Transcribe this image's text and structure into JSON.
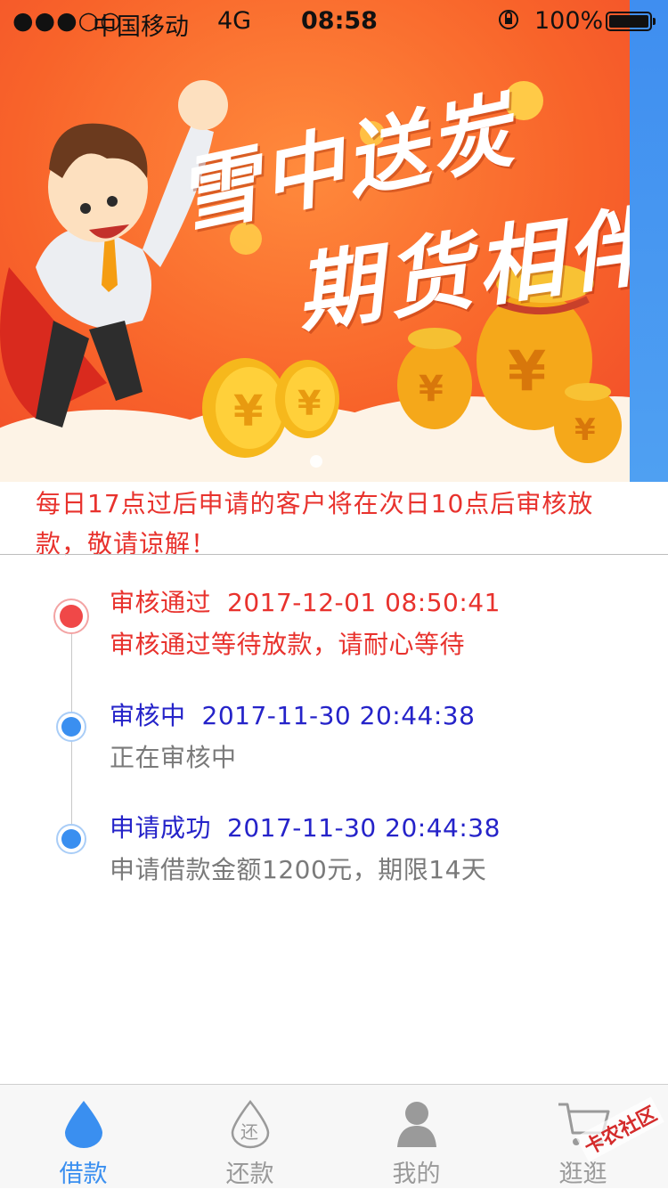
{
  "status_bar": {
    "signal": "●●●○○",
    "carrier": "中国移动",
    "network": "4G",
    "time": "08:58",
    "battery_pct": "100%"
  },
  "banner": {
    "title_line1": "雪中送炭",
    "title_line2": "期货相伴"
  },
  "notice": {
    "text": "每日17点过后申请的客户将在次日10点后审核放款，敬请谅解！"
  },
  "timeline": [
    {
      "status": "审核通过",
      "time": "2017-12-01 08:50:41",
      "desc": "审核通过等待放款，请耐心等待",
      "color": "#e8322d"
    },
    {
      "status": "审核中",
      "time": "2017-11-30 20:44:38",
      "desc": "正在审核中",
      "color": "#2523c9"
    },
    {
      "status": "申请成功",
      "time": "2017-11-30 20:44:38",
      "desc": "申请借款金额1200元，期限14天",
      "color": "#2523c9"
    }
  ],
  "tabbar": {
    "tabs": [
      {
        "label": "借款",
        "icon": "drop-icon",
        "active": true
      },
      {
        "label": "还款",
        "icon": "repay-icon",
        "active": false
      },
      {
        "label": "我的",
        "icon": "person-icon",
        "active": false
      },
      {
        "label": "逛逛",
        "icon": "cart-icon",
        "active": false
      }
    ]
  },
  "watermark": "卡农社区",
  "colors": {
    "accent_blue": "#3a8ff0",
    "accent_red": "#e8322d",
    "banner_orange": "#f8632a"
  }
}
